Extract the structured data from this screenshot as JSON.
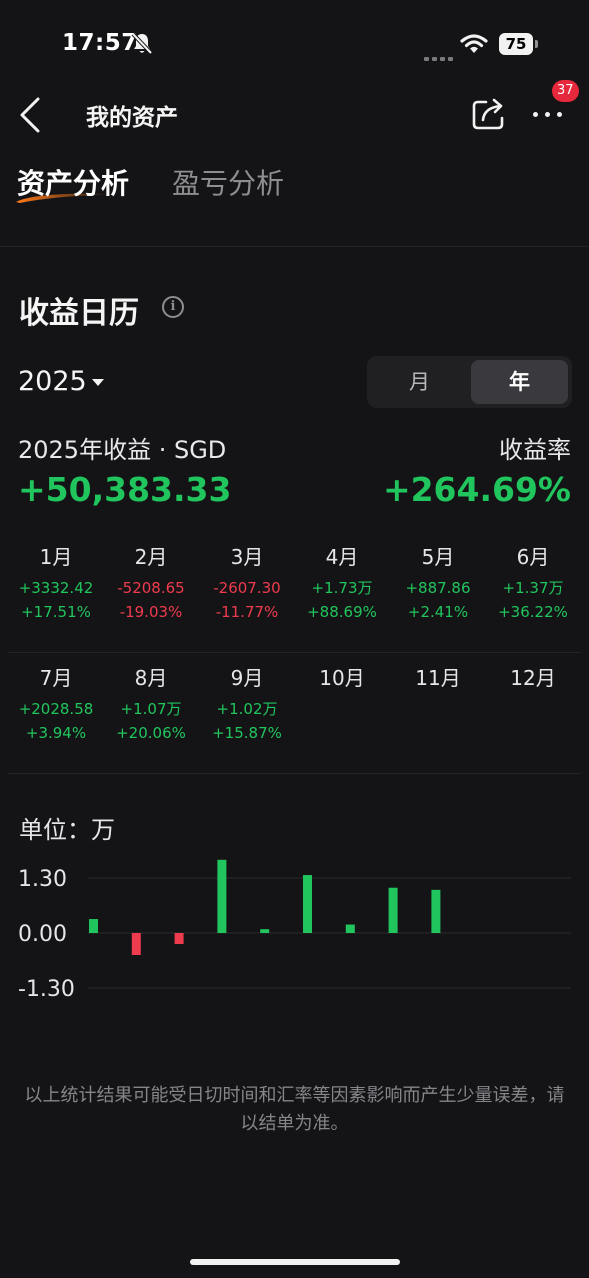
{
  "status_bar": {
    "time": "17:57",
    "battery": "75"
  },
  "nav": {
    "title": "我的资产",
    "badge_count": "37"
  },
  "tabs": [
    {
      "label": "资产分析",
      "active": true
    },
    {
      "label": "盈亏分析",
      "active": false
    }
  ],
  "calendar": {
    "title": "收益日历",
    "info_icon_glyph": "i",
    "year": "2025",
    "toggle": {
      "month_label": "月",
      "year_label": "年",
      "selected": "年"
    },
    "summary": {
      "label": "2025年收益 · SGD",
      "value": "+50,383.33",
      "rate_label": "收益率",
      "rate": "+264.69%"
    },
    "months": [
      {
        "name": "1月",
        "profit": "+3332.42",
        "rate": "+17.51%",
        "sign": "pos"
      },
      {
        "name": "2月",
        "profit": "-5208.65",
        "rate": "-19.03%",
        "sign": "neg"
      },
      {
        "name": "3月",
        "profit": "-2607.30",
        "rate": "-11.77%",
        "sign": "neg"
      },
      {
        "name": "4月",
        "profit": "+1.73万",
        "rate": "+88.69%",
        "sign": "pos"
      },
      {
        "name": "5月",
        "profit": "+887.86",
        "rate": "+2.41%",
        "sign": "pos"
      },
      {
        "name": "6月",
        "profit": "+1.37万",
        "rate": "+36.22%",
        "sign": "pos"
      },
      {
        "name": "7月",
        "profit": "+2028.58",
        "rate": "+3.94%",
        "sign": "pos"
      },
      {
        "name": "8月",
        "profit": "+1.07万",
        "rate": "+20.06%",
        "sign": "pos"
      },
      {
        "name": "9月",
        "profit": "+1.02万",
        "rate": "+15.87%",
        "sign": "pos"
      },
      {
        "name": "10月",
        "profit": "",
        "rate": "",
        "sign": "pos"
      },
      {
        "name": "11月",
        "profit": "",
        "rate": "",
        "sign": "pos"
      },
      {
        "name": "12月",
        "profit": "",
        "rate": "",
        "sign": "pos"
      }
    ]
  },
  "chart_data": {
    "type": "bar",
    "unit_label": "单位：万",
    "categories": [
      "1月",
      "2月",
      "3月",
      "4月",
      "5月",
      "6月",
      "7月",
      "8月",
      "9月",
      "10月",
      "11月",
      "12月"
    ],
    "values": [
      0.33,
      -0.52,
      -0.26,
      1.73,
      0.09,
      1.37,
      0.2,
      1.07,
      1.02,
      null,
      null,
      null
    ],
    "yticks": [
      "1.30",
      "0.00",
      "-1.30"
    ],
    "ylim": [
      -1.3,
      1.3
    ],
    "grid": true,
    "colors": {
      "positive": "#21c55d",
      "negative": "#ef3b4e",
      "grid": "#2a2a2e"
    }
  },
  "footnote": "以上统计结果可能受日切时间和汇率等因素影响而产生少量误差，请以结单为准。"
}
